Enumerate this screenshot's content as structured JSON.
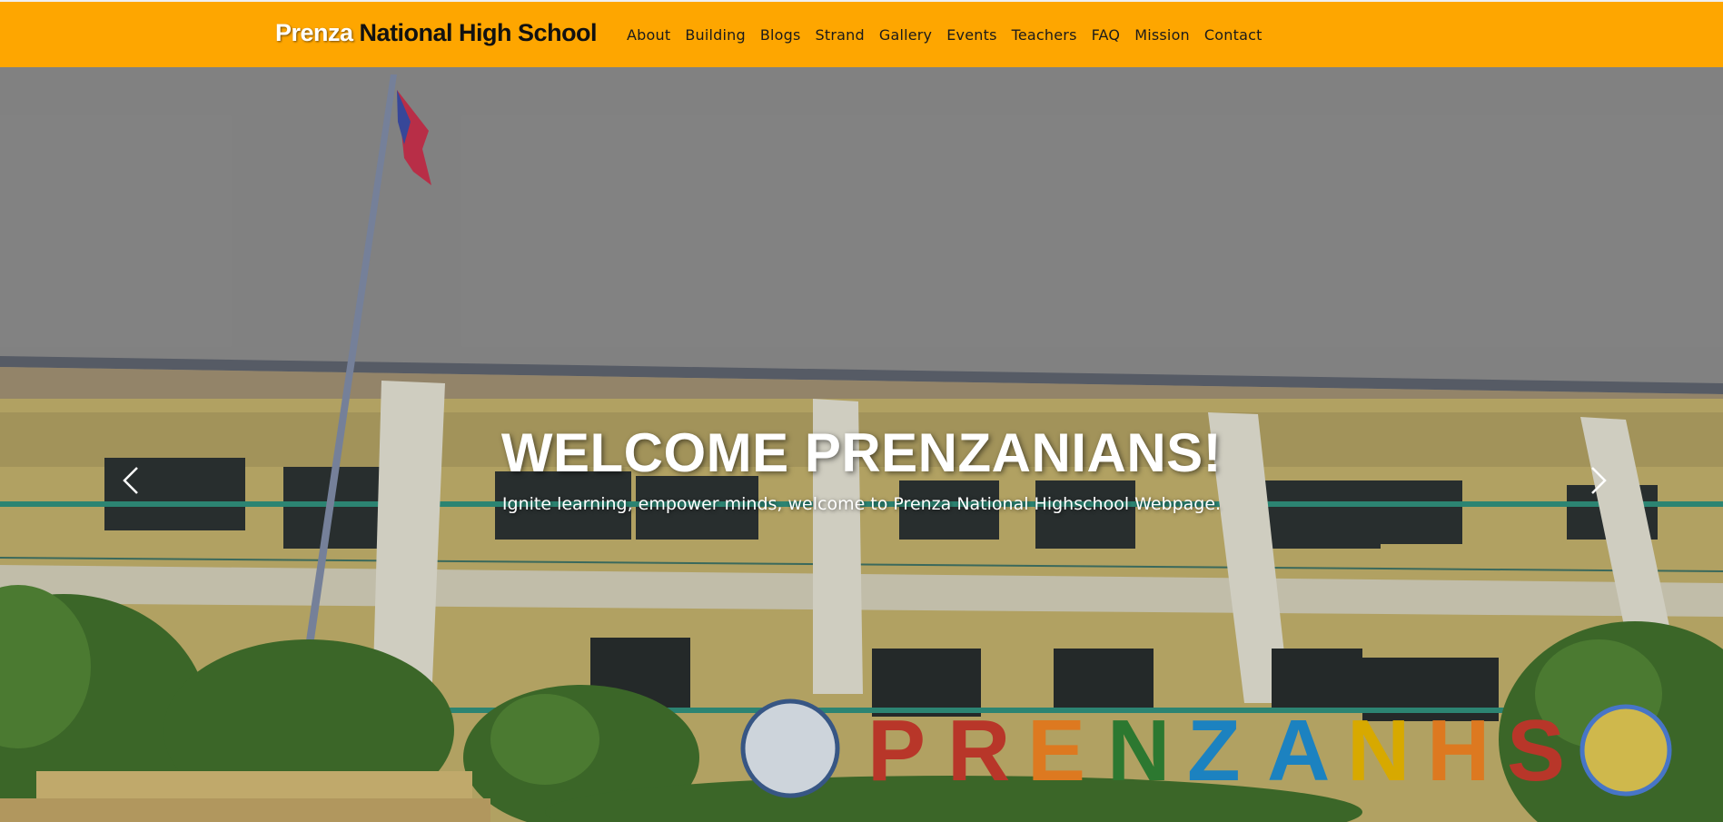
{
  "navbar": {
    "brand_first": "Prenza",
    "brand_rest": " National High School",
    "links": [
      "About",
      "Building",
      "Blogs",
      "Strand",
      "Gallery",
      "Events",
      "Teachers",
      "FAQ",
      "Mission",
      "Contact"
    ],
    "background_color": "#fea600"
  },
  "hero": {
    "title": "WELCOME PRENZANIANS!",
    "subtitle": "Ignite learning, empower minds, welcome to Prenza National Highschool Webpage.",
    "sign_letters": [
      "P",
      "R",
      "E",
      "N",
      "Z",
      "A",
      "N",
      "H",
      "S"
    ],
    "sign_colors": [
      "#c0392b",
      "#c0392b",
      "#e67e22",
      "#2e7d32",
      "#1e88c8",
      "#1e88c8",
      "#e0b000",
      "#e67e22",
      "#c0392b"
    ],
    "prev_icon": "chevron-left-icon",
    "next_icon": "chevron-right-icon"
  }
}
